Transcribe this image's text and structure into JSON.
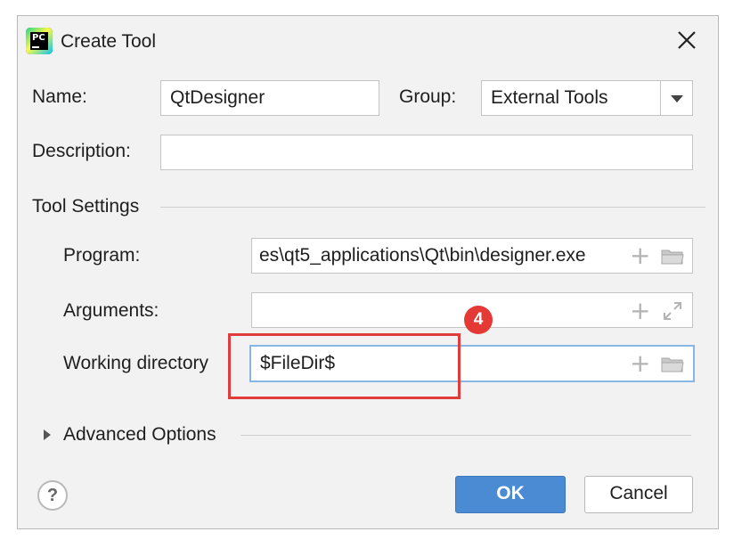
{
  "window": {
    "title": "Create Tool",
    "app_icon_text": "PC"
  },
  "form": {
    "name_label": "Name:",
    "name_value": "QtDesigner",
    "group_label": "Group:",
    "group_value": "External Tools",
    "description_label": "Description:",
    "description_value": ""
  },
  "tool_settings": {
    "section_label": "Tool Settings",
    "program_label": "Program:",
    "program_value": "es\\qt5_applications\\Qt\\bin\\designer.exe",
    "arguments_label": "Arguments:",
    "arguments_value": "",
    "workdir_label": "Working directory",
    "workdir_value": "$FileDir$"
  },
  "advanced": {
    "label": "Advanced Options"
  },
  "buttons": {
    "ok": "OK",
    "cancel": "Cancel",
    "help": "?"
  },
  "annotation": {
    "step_number": "4",
    "color": "#e53935"
  },
  "colors": {
    "ok_button": "#4a8bd3",
    "focus_border": "#87b5e6",
    "dialog_bg": "#f2f2f2"
  },
  "icons": [
    "pycharm-app-icon",
    "close-icon",
    "chevron-down-icon",
    "plus-icon",
    "folder-icon",
    "expand-icon",
    "triangle-right-icon",
    "help-icon"
  ]
}
